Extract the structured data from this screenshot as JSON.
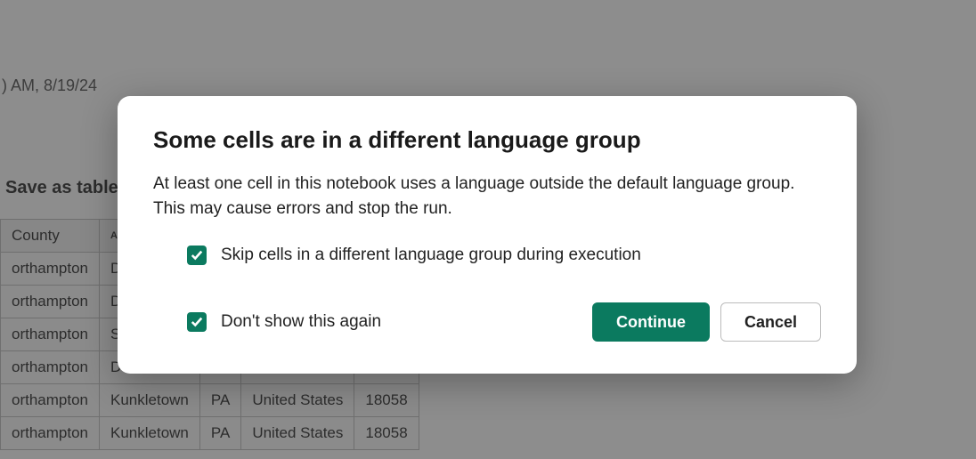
{
  "background": {
    "timestamp": ") AM, 8/19/24",
    "save_as_table": "Save as table",
    "table": {
      "headers": [
        "County",
        "A"
      ],
      "rows": [
        [
          "orthampton",
          "D",
          "",
          "",
          ""
        ],
        [
          "orthampton",
          "D",
          "",
          "",
          ""
        ],
        [
          "orthampton",
          "S",
          "",
          "",
          ""
        ],
        [
          "orthampton",
          "D",
          "",
          "",
          ""
        ],
        [
          "orthampton",
          "Kunkletown",
          "PA",
          "United States",
          "18058"
        ],
        [
          "orthampton",
          "Kunkletown",
          "PA",
          "United States",
          "18058"
        ]
      ]
    }
  },
  "dialog": {
    "title": "Some cells are in a different language group",
    "body": "At least one cell in this notebook uses a language outside the default language group. This may cause errors and stop the run.",
    "skip_label": "Skip cells in a different language group during execution",
    "dont_show_label": "Don't show this again",
    "continue": "Continue",
    "cancel": "Cancel"
  }
}
